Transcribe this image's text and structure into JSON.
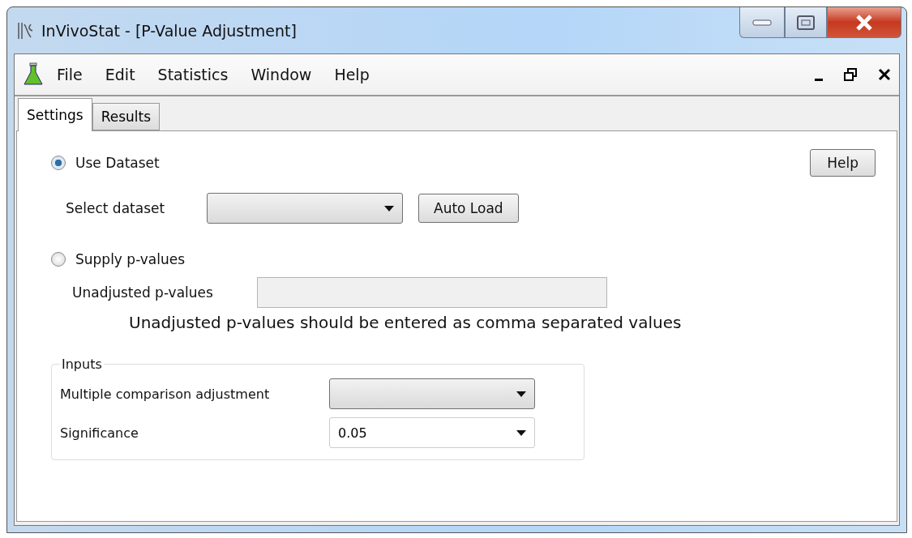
{
  "window": {
    "title": "InVivoStat - [P-Value Adjustment]"
  },
  "menu": [
    {
      "label": "File"
    },
    {
      "label": "Edit"
    },
    {
      "label": "Statistics"
    },
    {
      "label": "Window"
    },
    {
      "label": "Help"
    }
  ],
  "tabs": [
    {
      "label": "Settings",
      "selected": true
    },
    {
      "label": "Results",
      "selected": false
    }
  ],
  "help_button": "Help",
  "use_dataset": {
    "label": "Use Dataset",
    "selected": true,
    "select_label": "Select dataset",
    "auto_load": "Auto Load"
  },
  "supply_pvalues": {
    "label": "Supply p-values",
    "selected": false,
    "field_label": "Unadjusted p-values",
    "disabled": true
  },
  "note": "Unadjusted p-values should be entered as comma separated values",
  "inputs": {
    "title": "Inputs",
    "rows": [
      {
        "label": "Multiple comparison adjustment",
        "kind": "dropdown"
      },
      {
        "label": "Significance",
        "kind": "editable",
        "value": "0.05"
      }
    ]
  }
}
